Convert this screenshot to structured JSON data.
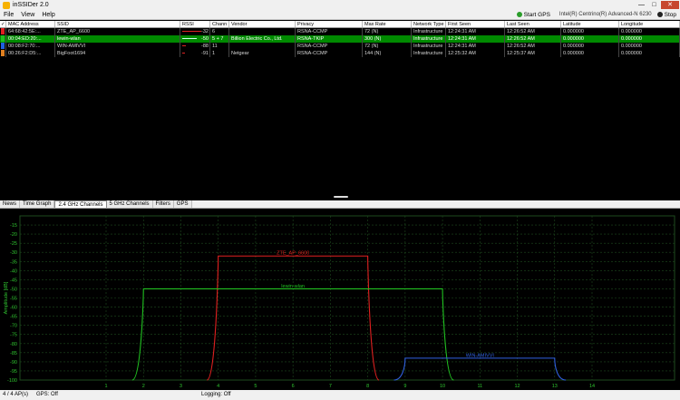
{
  "window": {
    "title": "inSSIDer 2.0",
    "minimize": "—",
    "maximize": "□",
    "close": "✕"
  },
  "menu": {
    "file": "File",
    "view": "View",
    "help": "Help"
  },
  "toolbar": {
    "start_gps": "Start GPS",
    "adapter": "Intel(R) Centrino(R) Advanced-N 6230",
    "stop": "Stop"
  },
  "table": {
    "headers": [
      "✓",
      "MAC Address",
      "SSID",
      "RSSI",
      "Chann",
      "Vendor",
      "Privacy",
      "Max Rate",
      "Network Type",
      "First Seen",
      "Last Seen",
      "Latitude",
      "Longitude"
    ],
    "rows": [
      {
        "color": "#e02020",
        "mac": "64:68:42:5E:...",
        "ssid": "ZTE_AP_6600",
        "rssi": "-32",
        "channel": "6",
        "vendor": "",
        "privacy": "RSNA-CCMP",
        "max_rate": "72 (N)",
        "network_type": "Infrastructure",
        "first_seen": "12:24:31 AM",
        "last_seen": "12:26:52 AM",
        "latitude": "0.000000",
        "longitude": "0.000000",
        "selected": false
      },
      {
        "color": "#20c020",
        "mac": "00:04:ED:20:...",
        "ssid": "lewin-wlan",
        "rssi": "-50",
        "channel": "5 + 7",
        "vendor": "Billion Electric Co., Ltd.",
        "privacy": "RSNA-TKIP",
        "max_rate": "300 (N)",
        "network_type": "Infrastructure",
        "first_seen": "12:24:31 AM",
        "last_seen": "12:26:52 AM",
        "latitude": "0.000000",
        "longitude": "0.000000",
        "selected": true
      },
      {
        "color": "#2060e0",
        "mac": "00:08:F2:70:...",
        "ssid": "WIN-AMIVVI",
        "rssi": "-88",
        "channel": "11",
        "vendor": "",
        "privacy": "RSNA-CCMP",
        "max_rate": "72 (N)",
        "network_type": "Infrastructure",
        "first_seen": "12:24:31 AM",
        "last_seen": "12:26:52 AM",
        "latitude": "0.000000",
        "longitude": "0.000000",
        "selected": false
      },
      {
        "color": "#e08020",
        "mac": "00:26:F2:D5:...",
        "ssid": "BigFoot1694",
        "rssi": "-91",
        "channel": "1",
        "vendor": "Netgear",
        "privacy": "RSNA-CCMP",
        "max_rate": "144 (N)",
        "network_type": "Infrastructure",
        "first_seen": "12:25:32 AM",
        "last_seen": "12:25:37 AM",
        "latitude": "0.000000",
        "longitude": "0.000000",
        "selected": false
      }
    ]
  },
  "tabs": [
    "News",
    "Time Graph",
    "2.4 GHz Channels",
    "5 GHz Channels",
    "Filters",
    "GPS"
  ],
  "active_tab": "2.4 GHz Channels",
  "chart_data": {
    "type": "line",
    "ylabel": "Amplitude [dB]",
    "ylim": [
      -100,
      -10
    ],
    "yticks": [
      -15,
      -20,
      -25,
      -30,
      -35,
      -40,
      -45,
      -50,
      -55,
      -60,
      -65,
      -70,
      -75,
      -80,
      -85,
      -90,
      -95,
      -100
    ],
    "xticks": [
      1,
      2,
      3,
      4,
      5,
      6,
      7,
      8,
      9,
      10,
      11,
      12,
      13,
      14
    ],
    "grid": true,
    "series": [
      {
        "name": "ZTE_AP_6600",
        "color": "#e02020",
        "center_channel": 6,
        "amplitude": -32,
        "width_channels": 4
      },
      {
        "name": "lewin-wlan",
        "color": "#20c020",
        "center_channel": 6,
        "amplitude": -50,
        "width_channels": 8
      },
      {
        "name": "WIN-AMIVVI",
        "color": "#3060e0",
        "center_channel": 11,
        "amplitude": -88,
        "width_channels": 4
      }
    ]
  },
  "status": {
    "ap_count": "4 / 4 AP(s)",
    "gps": "GPS: Off",
    "logging": "Logging: Off"
  }
}
